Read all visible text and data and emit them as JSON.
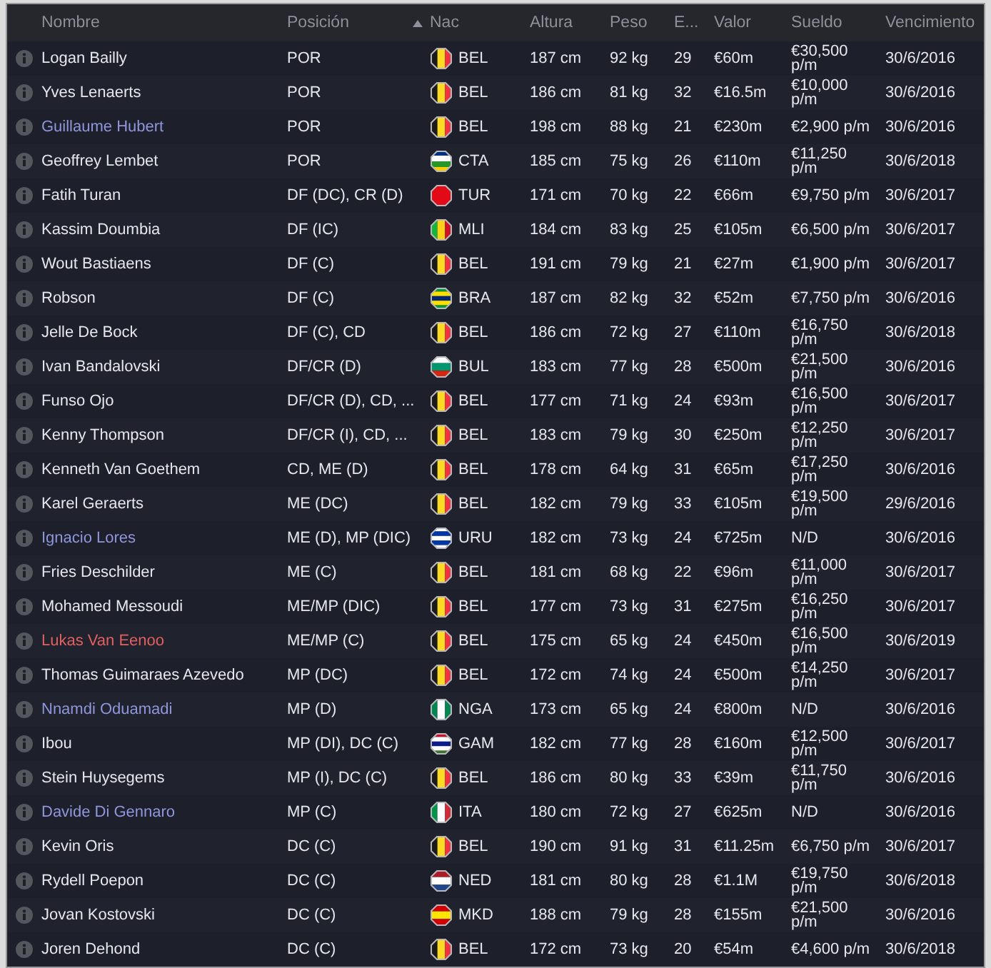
{
  "columns": [
    {
      "label": "Nombre",
      "sorted": false
    },
    {
      "label": "Posición",
      "sorted": false
    },
    {
      "label": "Nac",
      "sorted": true
    },
    {
      "label": "Altura",
      "sorted": false
    },
    {
      "label": "Peso",
      "sorted": false
    },
    {
      "label": "E...",
      "sorted": false
    },
    {
      "label": "Valor",
      "sorted": false
    },
    {
      "label": "Sueldo",
      "sorted": false
    },
    {
      "label": "Vencimiento",
      "sorted": false
    }
  ],
  "rows": [
    {
      "name": "Logan Bailly",
      "color": "#e6e7ec",
      "position": "POR",
      "flag": {
        "kind": "vertical",
        "stripes": [
          {
            "color": "#1a1a1a"
          },
          {
            "color": "#fdda24"
          },
          {
            "color": "#ef3340"
          }
        ]
      },
      "nat": "BEL",
      "height": "187 cm",
      "weight": "92 kg",
      "age": "29",
      "value": "€60m",
      "wage": "€30,500 p/m",
      "expires": "30/6/2016"
    },
    {
      "name": "Yves Lenaerts",
      "color": "#e6e7ec",
      "position": "POR",
      "flag": {
        "kind": "vertical",
        "stripes": [
          {
            "color": "#1a1a1a"
          },
          {
            "color": "#fdda24"
          },
          {
            "color": "#ef3340"
          }
        ]
      },
      "nat": "BEL",
      "height": "186 cm",
      "weight": "81 kg",
      "age": "32",
      "value": "€16.5m",
      "wage": "€10,000 p/m",
      "expires": "30/6/2016"
    },
    {
      "name": "Guillaume Hubert",
      "color": "#8f97dc",
      "position": "POR",
      "flag": {
        "kind": "vertical",
        "stripes": [
          {
            "color": "#1a1a1a"
          },
          {
            "color": "#fdda24"
          },
          {
            "color": "#ef3340"
          }
        ]
      },
      "nat": "BEL",
      "height": "198 cm",
      "weight": "88 kg",
      "age": "21",
      "value": "€230m",
      "wage": "€2,900 p/m",
      "expires": "30/6/2016"
    },
    {
      "name": "Geoffrey Lembet",
      "color": "#e6e7ec",
      "position": "POR",
      "flag": {
        "kind": "horizontal",
        "stripes": [
          {
            "color": "#003082"
          },
          {
            "color": "#ffffff"
          },
          {
            "color": "#289728"
          },
          {
            "color": "#ffce00"
          }
        ]
      },
      "nat": "CTA",
      "height": "185 cm",
      "weight": "75 kg",
      "age": "26",
      "value": "€110m",
      "wage": "€11,250 p/m",
      "expires": "30/6/2018"
    },
    {
      "name": "Fatih Turan",
      "color": "#e6e7ec",
      "position": "DF (DC), CR (D)",
      "flag": {
        "kind": "horizontal",
        "stripes": [
          {
            "color": "#e30a17"
          }
        ]
      },
      "nat": "TUR",
      "height": "171 cm",
      "weight": "70 kg",
      "age": "22",
      "value": "€66m",
      "wage": "€9,750 p/m",
      "expires": "30/6/2017"
    },
    {
      "name": "Kassim Doumbia",
      "color": "#e6e7ec",
      "position": "DF (IC)",
      "flag": {
        "kind": "vertical",
        "stripes": [
          {
            "color": "#14b53a"
          },
          {
            "color": "#fcd116"
          },
          {
            "color": "#ce1126"
          }
        ]
      },
      "nat": "MLI",
      "height": "184 cm",
      "weight": "83 kg",
      "age": "25",
      "value": "€105m",
      "wage": "€6,500 p/m",
      "expires": "30/6/2017"
    },
    {
      "name": "Wout Bastiaens",
      "color": "#e6e7ec",
      "position": "DF (C)",
      "flag": {
        "kind": "vertical",
        "stripes": [
          {
            "color": "#1a1a1a"
          },
          {
            "color": "#fdda24"
          },
          {
            "color": "#ef3340"
          }
        ]
      },
      "nat": "BEL",
      "height": "191 cm",
      "weight": "79 kg",
      "age": "21",
      "value": "€27m",
      "wage": "€1,900 p/m",
      "expires": "30/6/2017"
    },
    {
      "name": "Robson",
      "color": "#e6e7ec",
      "position": "DF (C)",
      "flag": {
        "kind": "horizontal",
        "stripes": [
          {
            "color": "#009c3b"
          },
          {
            "color": "#ffdf00"
          },
          {
            "color": "#002776"
          },
          {
            "color": "#ffdf00"
          },
          {
            "color": "#009c3b"
          }
        ]
      },
      "nat": "BRA",
      "height": "187 cm",
      "weight": "82 kg",
      "age": "32",
      "value": "€52m",
      "wage": "€7,750 p/m",
      "expires": "30/6/2016"
    },
    {
      "name": "Jelle De Bock",
      "color": "#e6e7ec",
      "position": "DF (C), CD",
      "flag": {
        "kind": "vertical",
        "stripes": [
          {
            "color": "#1a1a1a"
          },
          {
            "color": "#fdda24"
          },
          {
            "color": "#ef3340"
          }
        ]
      },
      "nat": "BEL",
      "height": "186 cm",
      "weight": "72 kg",
      "age": "27",
      "value": "€110m",
      "wage": "€16,750 p/m",
      "expires": "30/6/2018"
    },
    {
      "name": "Ivan Bandalovski",
      "color": "#e6e7ec",
      "position": "DF/CR (D)",
      "flag": {
        "kind": "horizontal",
        "stripes": [
          {
            "color": "#ffffff"
          },
          {
            "color": "#00966e"
          },
          {
            "color": "#d62612"
          }
        ]
      },
      "nat": "BUL",
      "height": "183 cm",
      "weight": "77 kg",
      "age": "28",
      "value": "€500m",
      "wage": "€21,500 p/m",
      "expires": "30/6/2016"
    },
    {
      "name": "Funso Ojo",
      "color": "#e6e7ec",
      "position": "DF/CR (D), CD, ...",
      "flag": {
        "kind": "vertical",
        "stripes": [
          {
            "color": "#1a1a1a"
          },
          {
            "color": "#fdda24"
          },
          {
            "color": "#ef3340"
          }
        ]
      },
      "nat": "BEL",
      "height": "177 cm",
      "weight": "71 kg",
      "age": "24",
      "value": "€93m",
      "wage": "€16,500 p/m",
      "expires": "30/6/2017"
    },
    {
      "name": "Kenny Thompson",
      "color": "#e6e7ec",
      "position": "DF/CR (I), CD, ...",
      "flag": {
        "kind": "vertical",
        "stripes": [
          {
            "color": "#1a1a1a"
          },
          {
            "color": "#fdda24"
          },
          {
            "color": "#ef3340"
          }
        ]
      },
      "nat": "BEL",
      "height": "183 cm",
      "weight": "79 kg",
      "age": "30",
      "value": "€250m",
      "wage": "€12,250 p/m",
      "expires": "30/6/2017"
    },
    {
      "name": "Kenneth Van Goethem",
      "color": "#e6e7ec",
      "position": "CD, ME (D)",
      "flag": {
        "kind": "vertical",
        "stripes": [
          {
            "color": "#1a1a1a"
          },
          {
            "color": "#fdda24"
          },
          {
            "color": "#ef3340"
          }
        ]
      },
      "nat": "BEL",
      "height": "178 cm",
      "weight": "64 kg",
      "age": "31",
      "value": "€65m",
      "wage": "€17,250 p/m",
      "expires": "30/6/2016"
    },
    {
      "name": "Karel Geraerts",
      "color": "#e6e7ec",
      "position": "ME (DC)",
      "flag": {
        "kind": "vertical",
        "stripes": [
          {
            "color": "#1a1a1a"
          },
          {
            "color": "#fdda24"
          },
          {
            "color": "#ef3340"
          }
        ]
      },
      "nat": "BEL",
      "height": "182 cm",
      "weight": "79 kg",
      "age": "33",
      "value": "€105m",
      "wage": "€19,500 p/m",
      "expires": "29/6/2016"
    },
    {
      "name": "Ignacio Lores",
      "color": "#8f97dc",
      "position": "ME (D), MP (DIC)",
      "flag": {
        "kind": "horizontal",
        "stripes": [
          {
            "color": "#ffffff"
          },
          {
            "color": "#0038a8"
          },
          {
            "color": "#ffffff"
          },
          {
            "color": "#0038a8"
          },
          {
            "color": "#ffffff"
          }
        ]
      },
      "nat": "URU",
      "height": "182 cm",
      "weight": "73 kg",
      "age": "24",
      "value": "€725m",
      "wage": "N/D",
      "expires": "30/6/2016"
    },
    {
      "name": "Fries Deschilder",
      "color": "#e6e7ec",
      "position": "ME (C)",
      "flag": {
        "kind": "vertical",
        "stripes": [
          {
            "color": "#1a1a1a"
          },
          {
            "color": "#fdda24"
          },
          {
            "color": "#ef3340"
          }
        ]
      },
      "nat": "BEL",
      "height": "181 cm",
      "weight": "68 kg",
      "age": "22",
      "value": "€96m",
      "wage": "€11,000 p/m",
      "expires": "30/6/2017"
    },
    {
      "name": "Mohamed Messoudi",
      "color": "#e6e7ec",
      "position": "ME/MP (DIC)",
      "flag": {
        "kind": "vertical",
        "stripes": [
          {
            "color": "#1a1a1a"
          },
          {
            "color": "#fdda24"
          },
          {
            "color": "#ef3340"
          }
        ]
      },
      "nat": "BEL",
      "height": "177 cm",
      "weight": "73 kg",
      "age": "31",
      "value": "€275m",
      "wage": "€16,250 p/m",
      "expires": "30/6/2017"
    },
    {
      "name": "Lukas Van Eenoo",
      "color": "#e2605f",
      "position": "ME/MP (C)",
      "flag": {
        "kind": "vertical",
        "stripes": [
          {
            "color": "#1a1a1a"
          },
          {
            "color": "#fdda24"
          },
          {
            "color": "#ef3340"
          }
        ]
      },
      "nat": "BEL",
      "height": "175 cm",
      "weight": "65 kg",
      "age": "24",
      "value": "€450m",
      "wage": "€16,500 p/m",
      "expires": "30/6/2019"
    },
    {
      "name": "Thomas Guimaraes Azevedo",
      "color": "#e6e7ec",
      "position": "MP (DC)",
      "flag": {
        "kind": "vertical",
        "stripes": [
          {
            "color": "#1a1a1a"
          },
          {
            "color": "#fdda24"
          },
          {
            "color": "#ef3340"
          }
        ]
      },
      "nat": "BEL",
      "height": "172 cm",
      "weight": "74 kg",
      "age": "24",
      "value": "€500m",
      "wage": "€14,250 p/m",
      "expires": "30/6/2017"
    },
    {
      "name": "Nnamdi Oduamadi",
      "color": "#8f97dc",
      "position": "MP (D)",
      "flag": {
        "kind": "vertical",
        "stripes": [
          {
            "color": "#008751"
          },
          {
            "color": "#ffffff"
          },
          {
            "color": "#008751"
          }
        ]
      },
      "nat": "NGA",
      "height": "173 cm",
      "weight": "65 kg",
      "age": "24",
      "value": "€800m",
      "wage": "N/D",
      "expires": "30/6/2016"
    },
    {
      "name": "Ibou",
      "color": "#e6e7ec",
      "position": "MP (DI), DC (C)",
      "flag": {
        "kind": "horizontal",
        "stripes": [
          {
            "color": "#ce1126"
          },
          {
            "color": "#ffffff"
          },
          {
            "color": "#0c1c8c"
          },
          {
            "color": "#ffffff"
          },
          {
            "color": "#3a7728"
          }
        ]
      },
      "nat": "GAM",
      "height": "182 cm",
      "weight": "77 kg",
      "age": "28",
      "value": "€160m",
      "wage": "€12,500 p/m",
      "expires": "30/6/2017"
    },
    {
      "name": "Stein Huysegems",
      "color": "#e6e7ec",
      "position": "MP (I), DC (C)",
      "flag": {
        "kind": "vertical",
        "stripes": [
          {
            "color": "#1a1a1a"
          },
          {
            "color": "#fdda24"
          },
          {
            "color": "#ef3340"
          }
        ]
      },
      "nat": "BEL",
      "height": "186 cm",
      "weight": "80 kg",
      "age": "33",
      "value": "€39m",
      "wage": "€11,750 p/m",
      "expires": "30/6/2016"
    },
    {
      "name": "Davide Di Gennaro",
      "color": "#8f97dc",
      "position": "MP (C)",
      "flag": {
        "kind": "vertical",
        "stripes": [
          {
            "color": "#009246"
          },
          {
            "color": "#ffffff"
          },
          {
            "color": "#ce2b37"
          }
        ]
      },
      "nat": "ITA",
      "height": "180 cm",
      "weight": "72 kg",
      "age": "27",
      "value": "€625m",
      "wage": "N/D",
      "expires": "30/6/2016"
    },
    {
      "name": "Kevin Oris",
      "color": "#e6e7ec",
      "position": "DC (C)",
      "flag": {
        "kind": "vertical",
        "stripes": [
          {
            "color": "#1a1a1a"
          },
          {
            "color": "#fdda24"
          },
          {
            "color": "#ef3340"
          }
        ]
      },
      "nat": "BEL",
      "height": "190 cm",
      "weight": "91 kg",
      "age": "31",
      "value": "€11.25m",
      "wage": "€6,750 p/m",
      "expires": "30/6/2017"
    },
    {
      "name": "Rydell Poepon",
      "color": "#e6e7ec",
      "position": "DC (C)",
      "flag": {
        "kind": "horizontal",
        "stripes": [
          {
            "color": "#ae1c28"
          },
          {
            "color": "#ffffff"
          },
          {
            "color": "#21468b"
          }
        ]
      },
      "nat": "NED",
      "height": "181 cm",
      "weight": "80 kg",
      "age": "28",
      "value": "€1.1M",
      "wage": "€19,750 p/m",
      "expires": "30/6/2018"
    },
    {
      "name": "Jovan Kostovski",
      "color": "#e6e7ec",
      "position": "DC (C)",
      "flag": {
        "kind": "horizontal",
        "stripes": [
          {
            "color": "#d20000"
          },
          {
            "color": "#ffe600"
          },
          {
            "color": "#d20000"
          }
        ]
      },
      "nat": "MKD",
      "height": "188 cm",
      "weight": "79 kg",
      "age": "28",
      "value": "€155m",
      "wage": "€21,500 p/m",
      "expires": "30/6/2016"
    },
    {
      "name": "Joren Dehond",
      "color": "#e6e7ec",
      "position": "DC (C)",
      "flag": {
        "kind": "vertical",
        "stripes": [
          {
            "color": "#1a1a1a"
          },
          {
            "color": "#fdda24"
          },
          {
            "color": "#ef3340"
          }
        ]
      },
      "nat": "BEL",
      "height": "172 cm",
      "weight": "73 kg",
      "age": "20",
      "value": "€54m",
      "wage": "€4,600 p/m",
      "expires": "30/6/2018"
    }
  ]
}
